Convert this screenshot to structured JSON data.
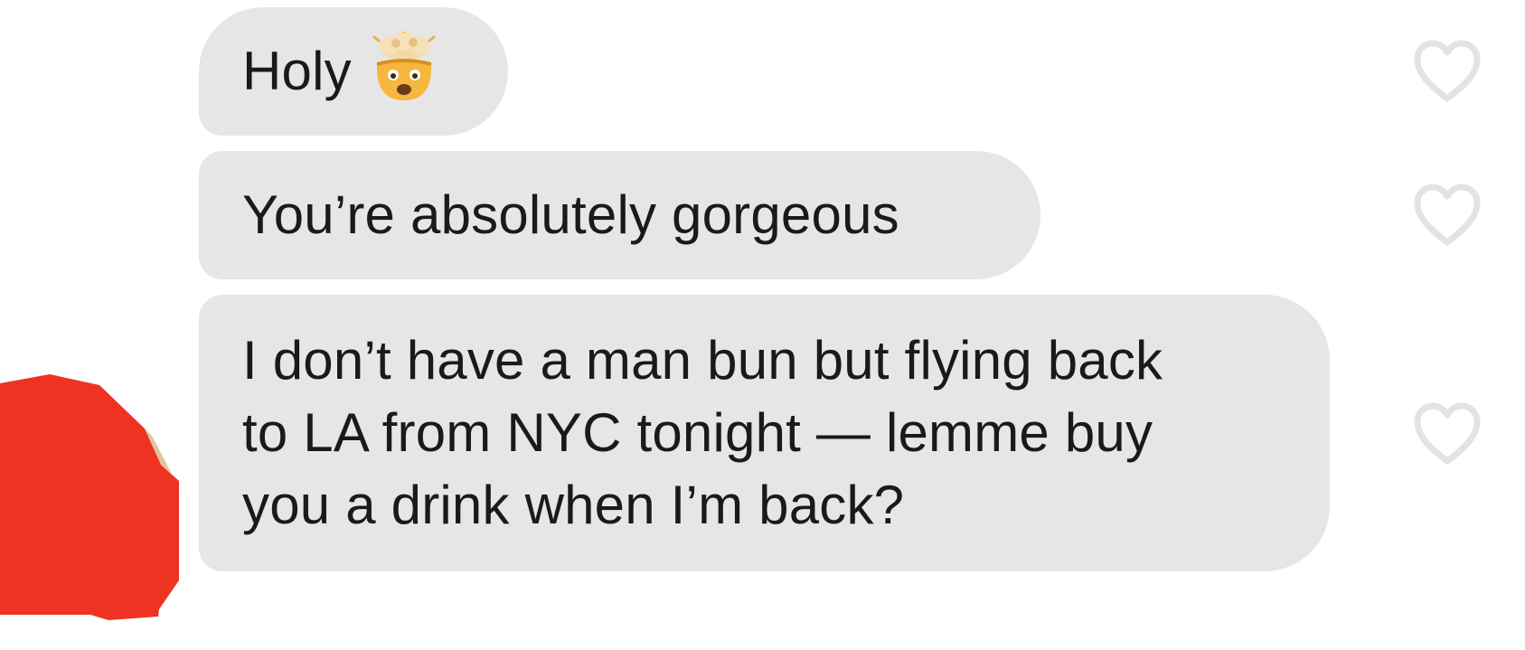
{
  "messages": [
    {
      "text": "Holy",
      "emoji": "exploding-head-emoji"
    },
    {
      "text": "You’re absolutely gorgeous"
    },
    {
      "text": "I don’t have a man bun but flying back\nto LA from NYC tonight — lemme buy\nyou a drink when I’m back?"
    }
  ],
  "icons": {
    "like": "heart-outline-icon",
    "avatar": "redacted-avatar"
  },
  "colors": {
    "bubble": "#e6e6e6",
    "text": "#1a1a1a",
    "heart": "#e3e3e3",
    "redaction": "#ee3322"
  }
}
